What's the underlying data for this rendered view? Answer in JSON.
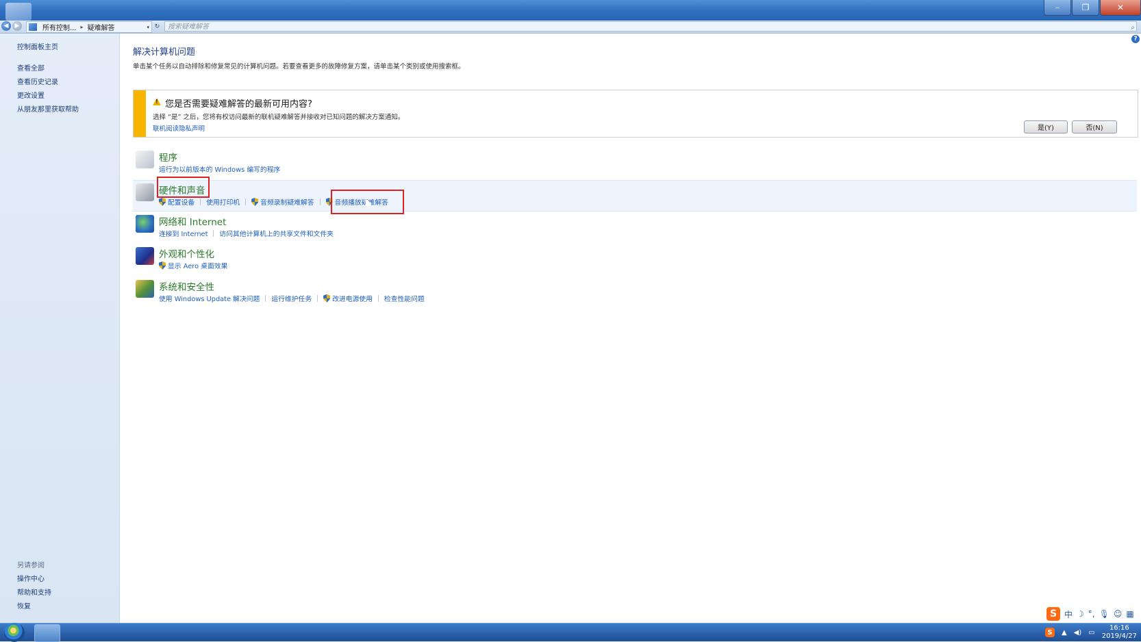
{
  "window": {
    "min_label": "–",
    "max_label": "❐",
    "close_label": "✕"
  },
  "address": {
    "back": "◀",
    "forward": "▶",
    "crumbs": [
      "所有控制...",
      "疑难解答"
    ],
    "separator": "▸",
    "dropdown": "▾",
    "refresh": "↻",
    "search_placeholder": "搜索疑难解答",
    "search_icon": "⌕"
  },
  "sidebar": {
    "items": [
      "控制面板主页",
      "查看全部",
      "查看历史记录",
      "更改设置",
      "从朋友那里获取帮助"
    ],
    "see_also_heading": "另请参阅",
    "see_also": [
      "操作中心",
      "帮助和支持",
      "恢复"
    ]
  },
  "main": {
    "help_icon": "?",
    "title": "解决计算机问题",
    "description": "单击某个任务以自动排除和修复常见的计算机问题。若要查看更多的故障修复方案，请单击某个类别或使用搜索框。",
    "infobar": {
      "title": "您是否需要疑难解答的最新可用内容?",
      "text": "选择 “是” 之后，您将有权访问最新的联机疑难解答并接收对已知问题的解决方案通知。",
      "link": "联机阅读隐私声明",
      "yes_label": "是(Y)",
      "no_label": "否(N)"
    },
    "categories": [
      {
        "title": "程序",
        "links": [
          {
            "label": "运行为以前版本的 Windows 编写的程序",
            "shield": false
          }
        ]
      },
      {
        "title": "硬件和声音",
        "links": [
          {
            "label": "配置设备",
            "shield": true
          },
          {
            "label": "使用打印机",
            "shield": false
          },
          {
            "label": "音频录制疑难解答",
            "shield": true
          },
          {
            "label": "音频播放疑难解答",
            "shield": true
          }
        ]
      },
      {
        "title": "网络和 Internet",
        "links": [
          {
            "label": "连接到 Internet",
            "shield": false
          },
          {
            "label": "访问其他计算机上的共享文件和文件夹",
            "shield": false
          }
        ]
      },
      {
        "title": "外观和个性化",
        "links": [
          {
            "label": "显示 Aero 桌面效果",
            "shield": true
          }
        ]
      },
      {
        "title": "系统和安全性",
        "links": [
          {
            "label": "使用 Windows Update 解决问题",
            "shield": false
          },
          {
            "label": "运行维护任务",
            "shield": false
          },
          {
            "label": "改进电源使用",
            "shield": true
          },
          {
            "label": "检查性能问题",
            "shield": false
          }
        ]
      }
    ]
  },
  "taskbar": {
    "time": "16:16",
    "date": "2019/4/27"
  },
  "ime": {
    "sogou": "S",
    "mode": "中",
    "moon": "☽",
    "punct": "°,",
    "mic": "🎙",
    "user": "☺",
    "grid": "▦"
  },
  "colors": {
    "link": "#1f5fbf",
    "category_title": "#2a7a2a",
    "page_title": "#1e3f8a",
    "infobar_accent": "#f7b500",
    "highlight_box": "#e02020"
  }
}
